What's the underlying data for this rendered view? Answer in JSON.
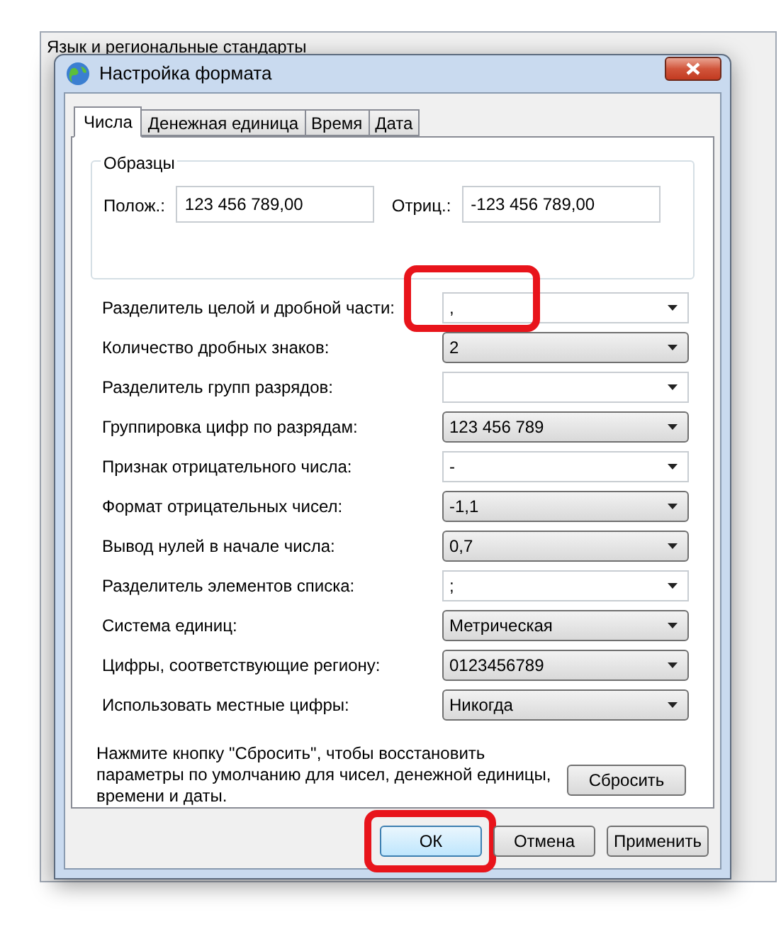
{
  "background_window": {
    "title": "Язык и региональные стандарты"
  },
  "window": {
    "title": "Настройка формата"
  },
  "tabs": [
    {
      "label": "Числа",
      "selected": true
    },
    {
      "label": "Денежная единица",
      "selected": false
    },
    {
      "label": "Время",
      "selected": false
    },
    {
      "label": "Дата",
      "selected": false
    }
  ],
  "samples": {
    "title": "Образцы",
    "positive_label": "Полож.:",
    "positive_value": "123 456 789,00",
    "negative_label": "Отриц.:",
    "negative_value": "-123 456 789,00"
  },
  "settings": [
    {
      "label": "Разделитель целой и дробной части:",
      "kind": "editable",
      "value": ",",
      "highlighted": true
    },
    {
      "label": "Количество дробных знаков:",
      "kind": "list",
      "value": "2",
      "highlighted": false
    },
    {
      "label": "Разделитель групп разрядов:",
      "kind": "editable",
      "highlighted": false
    },
    {
      "label": "Группировка цифр по разрядам:",
      "kind": "list",
      "value": "123 456 789",
      "highlighted": false
    },
    {
      "label": "Признак отрицательного числа:",
      "kind": "editable",
      "value": "-",
      "highlighted": false
    },
    {
      "label": "Формат отрицательных чисел:",
      "kind": "list",
      "value": "-1,1",
      "highlighted": false
    },
    {
      "label": "Вывод нулей в начале числа:",
      "kind": "list",
      "value": "0,7",
      "highlighted": false
    },
    {
      "label": "Разделитель элементов списка:",
      "kind": "editable",
      "value": ";",
      "highlighted": false
    },
    {
      "label": "Система единиц:",
      "kind": "list",
      "value": "Метрическая",
      "highlighted": false
    },
    {
      "label": "Цифры, соответствующие региону:",
      "kind": "list",
      "value": "0123456789",
      "highlighted": false
    },
    {
      "label": "Использовать местные цифры:",
      "kind": "list",
      "value": "Никогда",
      "highlighted": false
    }
  ],
  "reset": {
    "text": "Нажмите кнопку \"Сбросить\", чтобы восстановить параметры по умолчанию для чисел, денежной единицы, времени и даты.",
    "button": "Сбросить"
  },
  "buttons": [
    {
      "label": "ОК",
      "highlighted": true
    },
    {
      "label": "Отмена",
      "highlighted": false
    },
    {
      "label": "Применить",
      "highlighted": false
    }
  ]
}
